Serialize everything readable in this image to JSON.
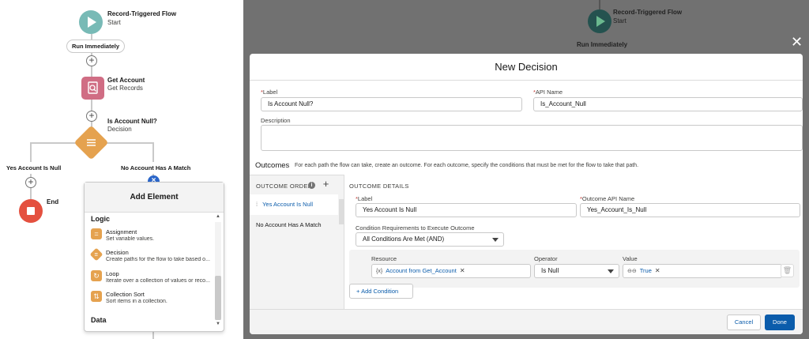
{
  "canvas": {
    "start": {
      "title": "Record-Triggered Flow",
      "subtitle": "Start"
    },
    "run_pill": "Run Immediately",
    "get_account": {
      "title": "Get Account",
      "subtitle": "Get Records"
    },
    "decision": {
      "title": "Is Account Null?",
      "subtitle": "Decision"
    },
    "branch_left": "Yes Account Is Null",
    "branch_right": "No Account Has A Match",
    "end_label": "End",
    "add_element": {
      "title": "Add Element",
      "logic_heading": "Logic",
      "items": [
        {
          "title": "Assignment",
          "desc": "Set variable values.",
          "icon": "assignment-icon"
        },
        {
          "title": "Decision",
          "desc": "Create paths for the flow to take based o...",
          "icon": "decision-icon"
        },
        {
          "title": "Loop",
          "desc": "Iterate over a collection of values or reco...",
          "icon": "loop-icon"
        },
        {
          "title": "Collection Sort",
          "desc": "Sort items in a collection.",
          "icon": "sort-icon"
        }
      ],
      "data_heading": "Data"
    }
  },
  "background_flow": {
    "title": "Record-Triggered Flow",
    "subtitle": "Start",
    "run_pill": "Run Immediately"
  },
  "modal": {
    "title": "New Decision",
    "label_label": "Label",
    "label_value": "Is Account Null?",
    "api_label": "API Name",
    "api_value": "Is_Account_Null",
    "description_label": "Description",
    "description_value": "",
    "outcomes_title": "Outcomes",
    "outcomes_desc": "For each path the flow can take, create an outcome. For each outcome, specify the conditions that must be met for the flow to take that path.",
    "outcome_order_label": "OUTCOME ORDER",
    "outcomes": [
      "Yes Account Is Null",
      "No Account Has A Match"
    ],
    "details_title": "OUTCOME DETAILS",
    "outcome_label_label": "Label",
    "outcome_label_value": "Yes Account Is Null",
    "outcome_api_label": "Outcome API Name",
    "outcome_api_value": "Yes_Account_Is_Null",
    "cond_req_label": "Condition Requirements to Execute Outcome",
    "cond_req_value": "All Conditions Are Met (AND)",
    "resource_label": "Resource",
    "operator_label": "Operator",
    "value_label": "Value",
    "resource_value": "Account from Get_Account",
    "operator_value": "Is Null",
    "value_value": "True",
    "add_condition_label": "Add Condition",
    "cancel_label": "Cancel",
    "done_label": "Done"
  },
  "colors": {
    "start": "#0b827c",
    "get_records": "#d06d84",
    "decision": "#e5a24f",
    "end": "#e4503f",
    "brand_blue": "#0b5cab"
  }
}
